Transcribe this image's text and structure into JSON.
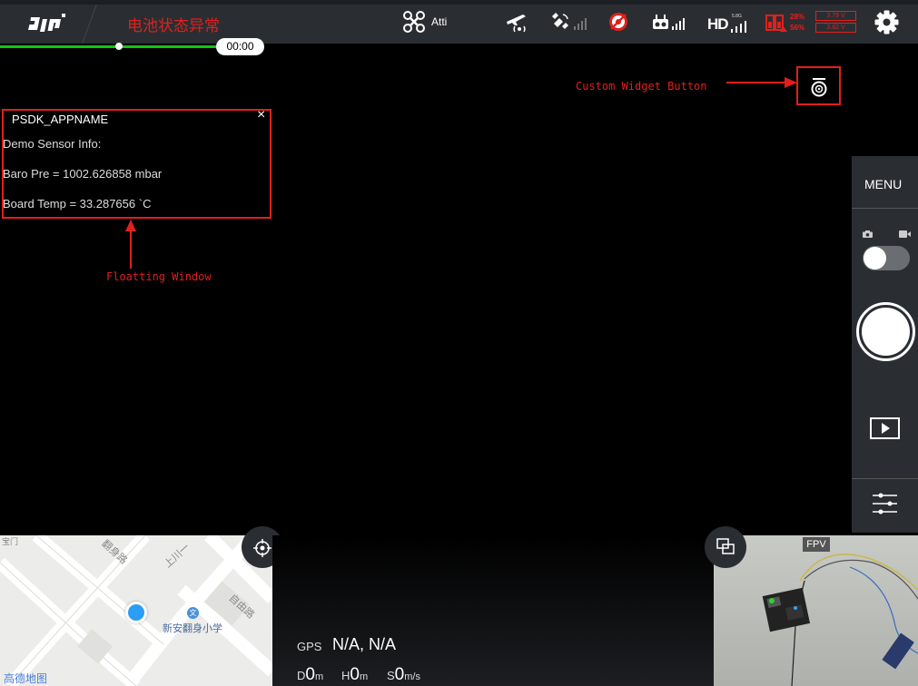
{
  "topbar": {
    "warning": "电池状态异常",
    "mode": "Atti",
    "hd_label": "HD",
    "hd_small": "5.8G",
    "battery": {
      "pct_top": "28%",
      "pct_bottom": "56%",
      "volt_top": "3.79 V",
      "volt_bottom": "3.82 V"
    },
    "icons": [
      "dji-logo",
      "aircraft-mode-icon",
      "takeoff-signal-icon",
      "gps-satellite-icon",
      "obstacle-avoid-icon",
      "remote-controller-signal-icon",
      "hd-signal-icon",
      "battery-warning-icon",
      "gear-icon"
    ]
  },
  "playback": {
    "time": "00:00",
    "progress": 0.53
  },
  "custom_widget": {
    "label": "Custom Widget Button"
  },
  "floating_window": {
    "title": "PSDK_APPNAME",
    "close": "×",
    "lines": [
      "Demo Sensor Info:",
      "Baro Pre = 1002.626858 mbar",
      "Board Temp = 33.287656 `C"
    ],
    "label": "Floatting Window"
  },
  "right_panel": {
    "menu": "MENU"
  },
  "map": {
    "school": "新安翻身小学",
    "school_icon": "文",
    "roads": [
      "翻身路",
      "上川一",
      "自由路",
      "宝门"
    ],
    "brand": "高德地图"
  },
  "telemetry": {
    "gps_label": "GPS",
    "gps_value": "N/A, N/A",
    "d_label": "D",
    "d_value": "0",
    "d_unit": "m",
    "h_label": "H",
    "h_value": "0",
    "h_unit": "m",
    "s_label": "S",
    "s_value": "0",
    "s_unit": "m/s"
  },
  "fpv": {
    "tag": "FPV"
  },
  "colors": {
    "accent_red": "#e0201c",
    "progress_green": "#14c414",
    "bar_bg": "#2a2e33"
  }
}
